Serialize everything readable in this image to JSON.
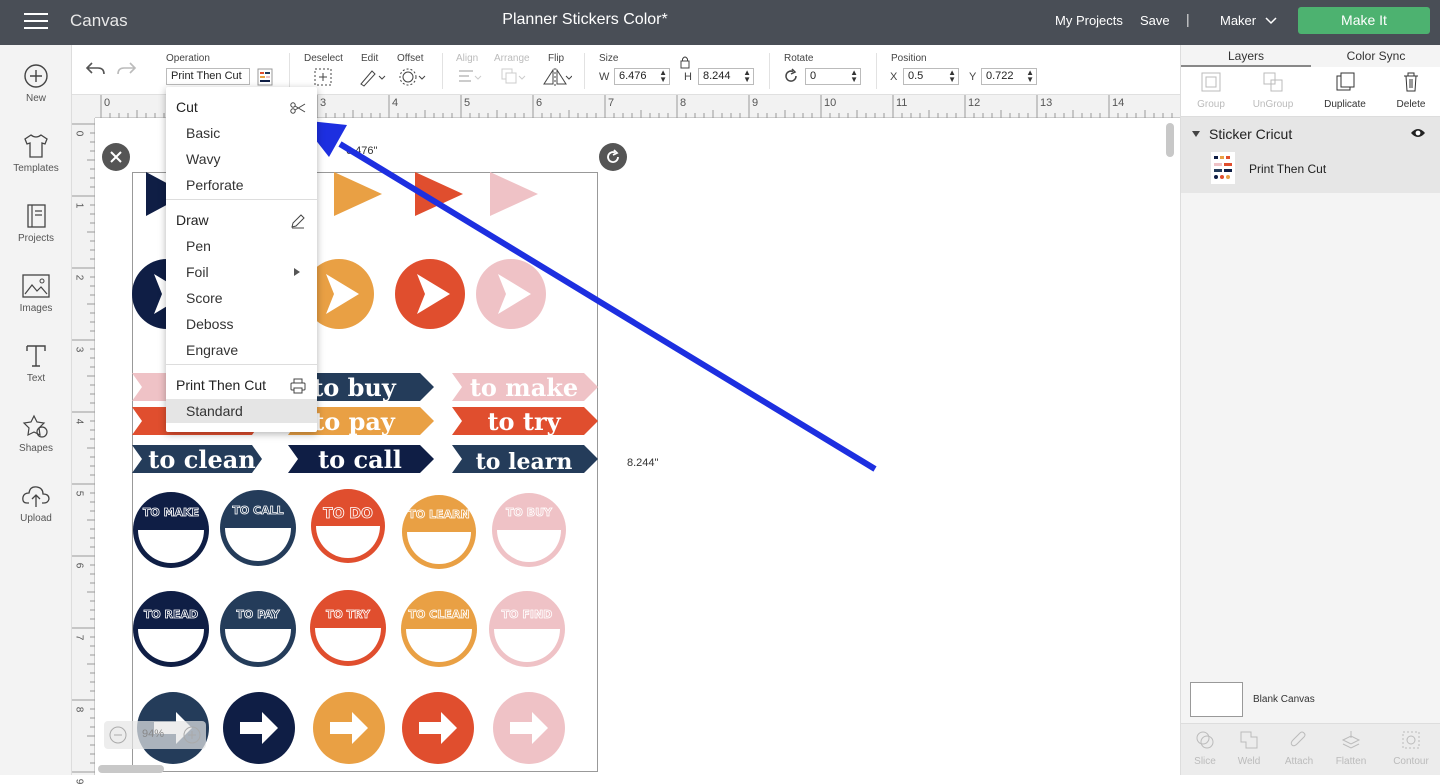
{
  "topbar": {
    "app_name": "Canvas",
    "doc_title": "Planner Stickers Color*",
    "my_projects": "My Projects",
    "save": "Save",
    "separator": "|",
    "machine": "Maker",
    "make_it": "Make It",
    "accent_color": "#4db270"
  },
  "sidebar": {
    "items": [
      {
        "label": "New",
        "icon": "plus-circle-icon"
      },
      {
        "label": "Templates",
        "icon": "tshirt-icon"
      },
      {
        "label": "Projects",
        "icon": "book-icon"
      },
      {
        "label": "Images",
        "icon": "image-icon"
      },
      {
        "label": "Text",
        "icon": "text-icon"
      },
      {
        "label": "Shapes",
        "icon": "shapes-icon"
      },
      {
        "label": "Upload",
        "icon": "cloud-upload-icon"
      }
    ]
  },
  "toolbar": {
    "operation_label": "Operation",
    "operation_value": "Print Then Cut ▾",
    "deselect": "Deselect",
    "edit": "Edit",
    "offset": "Offset",
    "align": "Align",
    "arrange": "Arrange",
    "flip": "Flip",
    "size": "Size",
    "w_label": "W",
    "w_value": "6.476",
    "h_label": "H",
    "h_value": "8.244",
    "rotate": "Rotate",
    "rotate_value": "0",
    "position": "Position",
    "x_label": "X",
    "x_value": "0.5",
    "y_label": "Y",
    "y_value": "0.722"
  },
  "ruler": {
    "h_ticks": [
      "0",
      "1",
      "2",
      "3",
      "4",
      "5",
      "6",
      "7",
      "8",
      "9",
      "10",
      "11",
      "12",
      "13",
      "14"
    ],
    "v_ticks": [
      "0",
      "1",
      "2",
      "3",
      "4",
      "5",
      "6",
      "7",
      "8",
      "9"
    ]
  },
  "canvas": {
    "width_label": "6.476\"",
    "height_label": "8.244\"",
    "zoom": "94%",
    "stickers": {
      "banners": [
        "to buy",
        "to make",
        "to pay",
        "to try",
        "to clean",
        "to call",
        "to learn"
      ],
      "labels_row1": [
        "TO MAKE",
        "TO CALL",
        "TO DO",
        "TO LEARN",
        "TO BUY"
      ],
      "labels_row2": [
        "TO READ",
        "TO PAY",
        "TO TRY",
        "TO CLEAN",
        "TO FIND"
      ]
    },
    "palette": {
      "navy": "#0f1e45",
      "slate": "#243c5a",
      "orange": "#e9a044",
      "red": "#e04e2e",
      "pink": "#efc2c6"
    }
  },
  "operation_menu": {
    "cut_header": "Cut",
    "cut_items": [
      "Basic",
      "Wavy",
      "Perforate"
    ],
    "draw_header": "Draw",
    "draw_items": [
      "Pen",
      "Foil",
      "Score",
      "Deboss",
      "Engrave"
    ],
    "ptc_header": "Print Then Cut",
    "ptc_items": [
      "Standard"
    ],
    "selected": "Standard"
  },
  "right_panel": {
    "tabs": [
      "Layers",
      "Color Sync"
    ],
    "actions": [
      "Group",
      "UnGroup",
      "Duplicate",
      "Delete"
    ],
    "group_name": "Sticker Cricut",
    "layer_name": "Print Then Cut",
    "blank_canvas": "Blank Canvas",
    "bottom_actions": [
      "Slice",
      "Weld",
      "Attach",
      "Flatten",
      "Contour"
    ]
  },
  "annotation": {
    "arrow_color": "#1d2fe0"
  }
}
